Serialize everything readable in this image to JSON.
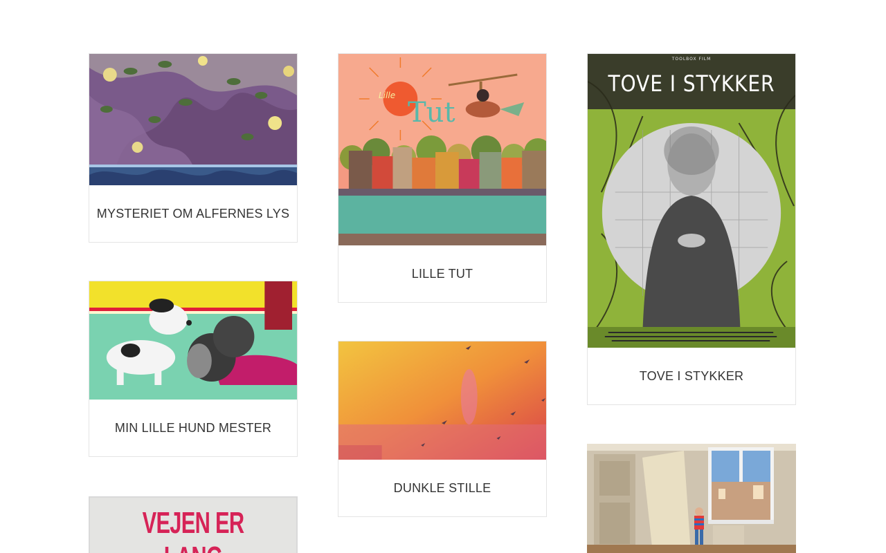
{
  "cards": [
    {
      "title": "MYSTERIET OM ALFERNES LYS"
    },
    {
      "title": "MIN LILLE HUND MESTER"
    },
    {
      "title": "LILLE TUT",
      "poster_text_a": "Lille",
      "poster_text_b": "Tut"
    },
    {
      "title": "DUNKLE STILLE"
    },
    {
      "title": "TOVE I STYKKER",
      "poster_text": "TOVE I STYKKER",
      "poster_studio": "TOOLBOX FILM"
    },
    {
      "title": "",
      "poster_text": "VEJEN ER LANG"
    },
    {
      "title": ""
    }
  ],
  "colors": {
    "border": "#e4e4e4",
    "caption_text": "#333333",
    "poster_red": "#d62357",
    "tove_green": "#8fb33a"
  }
}
